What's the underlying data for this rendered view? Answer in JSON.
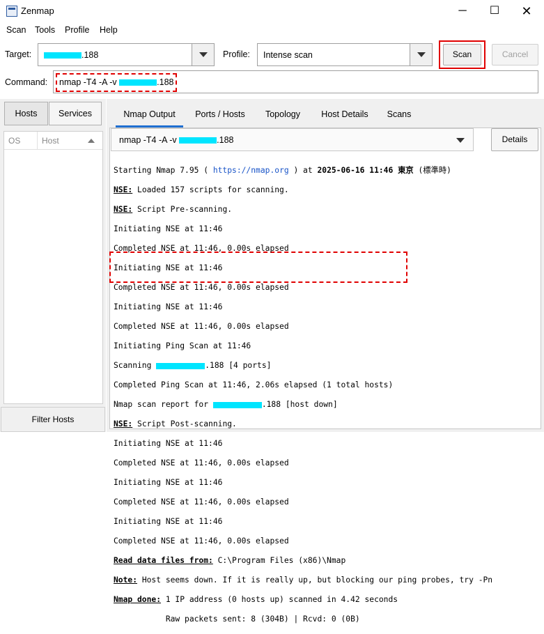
{
  "window": {
    "title": "Zenmap",
    "minimize_glyph": "─",
    "maximize_glyph": "☐",
    "close_glyph": "✕"
  },
  "menu": [
    "Scan",
    "Tools",
    "Profile",
    "Help"
  ],
  "target": {
    "label": "Target:",
    "value_suffix": ".188"
  },
  "profile": {
    "label": "Profile:",
    "value": "Intense scan"
  },
  "buttons": {
    "scan": "Scan",
    "cancel": "Cancel",
    "details": "Details",
    "filter_hosts": "Filter Hosts"
  },
  "command": {
    "label": "Command:",
    "prefix": "nmap -T4 -A -v ",
    "suffix": ".188"
  },
  "left_tabs": [
    "Hosts",
    "Services"
  ],
  "host_columns": [
    "OS",
    "Host"
  ],
  "right_tabs": [
    "Nmap Output",
    "Ports / Hosts",
    "Topology",
    "Host Details",
    "Scans"
  ],
  "output_combo": {
    "prefix": "nmap -T4 -A -v ",
    "suffix": ".188"
  },
  "output": {
    "l1a": "Starting Nmap 7.95 ( ",
    "l1link": "https://nmap.org",
    "l1b": " ) at ",
    "l1date": "2025-06-16 11:46 東京",
    "l1c": " (標準時)",
    "nse": "NSE:",
    "l2": " Loaded 157 scripts for scanning.",
    "l3": " Script Pre-scanning.",
    "init_nse": "Initiating NSE at 11:46",
    "done_nse": "Completed NSE at 11:46, 0.00s elapsed",
    "ping": "Initiating Ping Scan at 11:46",
    "scanning_a": "Scanning ",
    "scanning_b": ".188 [4 ports]",
    "ping_done": "Completed Ping Scan at 11:46, 2.06s elapsed (1 total hosts)",
    "report_a": "Nmap scan report for ",
    "report_b": ".188 [host down]",
    "post": " Script Post-scanning.",
    "read_label": "Read data files from:",
    "read_val": " C:\\Program Files (x86)\\Nmap",
    "note_label": "Note:",
    "note_val": " Host seems down. If it is really up, but blocking our ping probes, try -Pn",
    "done_label": "Nmap done:",
    "done_val": " 1 IP address (0 hosts up) scanned in 4.42 seconds",
    "raw": "           Raw packets sent: 8 (304B) | Rcvd: 0 (0B)"
  }
}
